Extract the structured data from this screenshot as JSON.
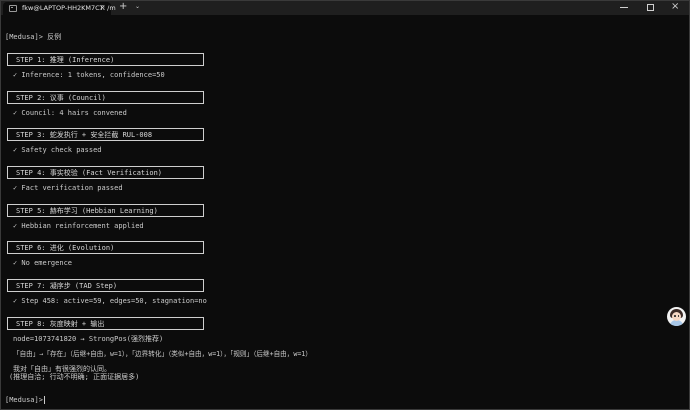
{
  "window": {
    "tab_title": "fkw@LAPTOP-HH2KM7CT: /m",
    "tab_close": "×",
    "new_tab": "+",
    "tab_dropdown": "⌄",
    "minimize": "",
    "maximize": "",
    "close": "×"
  },
  "terminal": {
    "command_line": "[Medusa]> 反例",
    "steps": [
      {
        "label": "STEP 1: 推理 (Inference)",
        "result": "✓ Inference: 1 tokens, confidence=50"
      },
      {
        "label": "STEP 2: 议事 (Council)",
        "result": "✓ Council: 4 hairs convened"
      },
      {
        "label": "STEP 3: 蛇发执行 + 安全拦截 RUL-008",
        "result": "✓ Safety check passed"
      },
      {
        "label": "STEP 4: 事实校验 (Fact Verification)",
        "result": "✓ Fact verification passed"
      },
      {
        "label": "STEP 5: 赫布学习 (Hebbian Learning)",
        "result": "✓ Hebbian reinforcement applied"
      },
      {
        "label": "STEP 6: 进化 (Evolution)",
        "result": "✓ No emergence"
      },
      {
        "label": "STEP 7: 凝序步 (TAD Step)",
        "result": "✓ Step 458: active=59, edges=50, stagnation=no"
      },
      {
        "label": "STEP 8: 灰度映射 + 输出",
        "result": ""
      }
    ],
    "node_line": "node=1073741820 → StrongPos(强烈推荐)",
    "relation_line": "「自由」→「存在」（后继+自由，w=1），「边界转化」（类似+自由，w=1），「规则」（后继+自由，w=1）",
    "belief_line": "我对「自由」有很强烈的认同。",
    "note_line": "(推理自洽; 行动不明确; 正面证据居多)",
    "prompt": "[Medusa]>"
  },
  "colors": {
    "background": "#0c0c0c",
    "text": "#cccccc",
    "titlebar": "#1f1f1f",
    "box_border": "#cfcfcf"
  }
}
